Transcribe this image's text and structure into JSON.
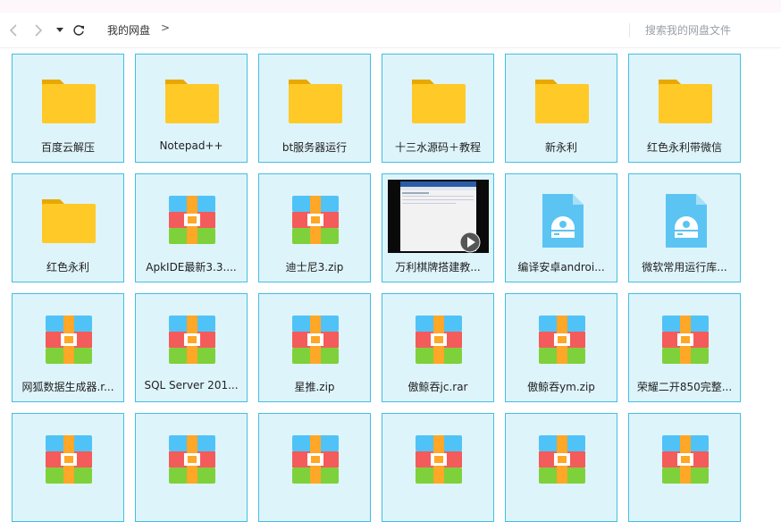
{
  "toolbar": {
    "breadcrumb_root": "我的网盘",
    "breadcrumb_sep": ">",
    "search_placeholder": "搜索我的网盘文件"
  },
  "colors": {
    "tile_bg": "#def4fb",
    "tile_border": "#41bfe3",
    "folder_yellow": "#ffca28"
  },
  "items": [
    {
      "name": "百度云解压",
      "icon": "folder-icon"
    },
    {
      "name": "Notepad++",
      "icon": "folder-icon"
    },
    {
      "name": "bt服务器运行",
      "icon": "folder-icon"
    },
    {
      "name": "十三水源码＋教程",
      "icon": "folder-icon"
    },
    {
      "name": "新永利",
      "icon": "folder-icon"
    },
    {
      "name": "红色永利带微信",
      "icon": "folder-icon"
    },
    {
      "name": "红色永利",
      "icon": "folder-icon"
    },
    {
      "name": "ApkIDE最新3.3....",
      "icon": "archive-icon"
    },
    {
      "name": "迪士尼3.zip",
      "icon": "archive-icon"
    },
    {
      "name": "万利棋牌搭建教...",
      "icon": "video-thumbnail"
    },
    {
      "name": "编译安卓androi...",
      "icon": "disc-image-icon"
    },
    {
      "name": "微软常用运行库...",
      "icon": "disc-image-icon"
    },
    {
      "name": "网狐数据生成器.r...",
      "icon": "archive-icon"
    },
    {
      "name": "SQL Server 201...",
      "icon": "archive-icon"
    },
    {
      "name": "星推.zip",
      "icon": "archive-icon"
    },
    {
      "name": "傲鲸吞jc.rar",
      "icon": "archive-icon"
    },
    {
      "name": "傲鲸吞ym.zip",
      "icon": "archive-icon"
    },
    {
      "name": "荣耀二开850完整...",
      "icon": "archive-icon"
    },
    {
      "name": "",
      "icon": "archive-icon"
    },
    {
      "name": "",
      "icon": "archive-icon"
    },
    {
      "name": "",
      "icon": "archive-icon"
    },
    {
      "name": "",
      "icon": "archive-icon"
    },
    {
      "name": "",
      "icon": "archive-icon"
    },
    {
      "name": "",
      "icon": "archive-icon"
    }
  ]
}
